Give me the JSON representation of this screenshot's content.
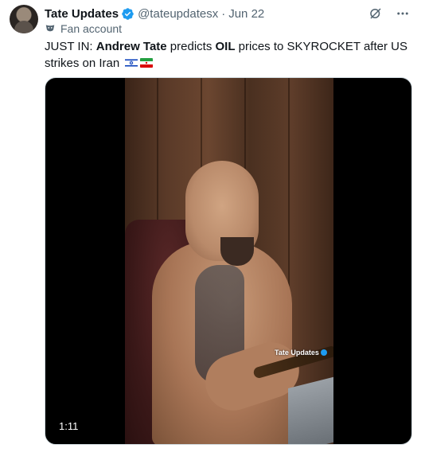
{
  "tweet": {
    "author_name": "Tate Updates",
    "handle": "@tateupdatesx",
    "separator": "·",
    "date": "Jun 22",
    "label": "Fan account",
    "text_prefix": "JUST IN: ",
    "text_bold1": "Andrew Tate",
    "text_mid1": " predicts ",
    "text_bold2": "OIL",
    "text_mid2": " prices to SKYROCKET after US strikes on Iran",
    "flags": [
      "israel-flag-icon",
      "iran-flag-icon"
    ]
  },
  "media": {
    "watermark": "Tate Updates",
    "duration": "1:11"
  },
  "colors": {
    "accent": "#1d9bf0",
    "secondary_text": "#536471",
    "primary_text": "#0f1419"
  }
}
